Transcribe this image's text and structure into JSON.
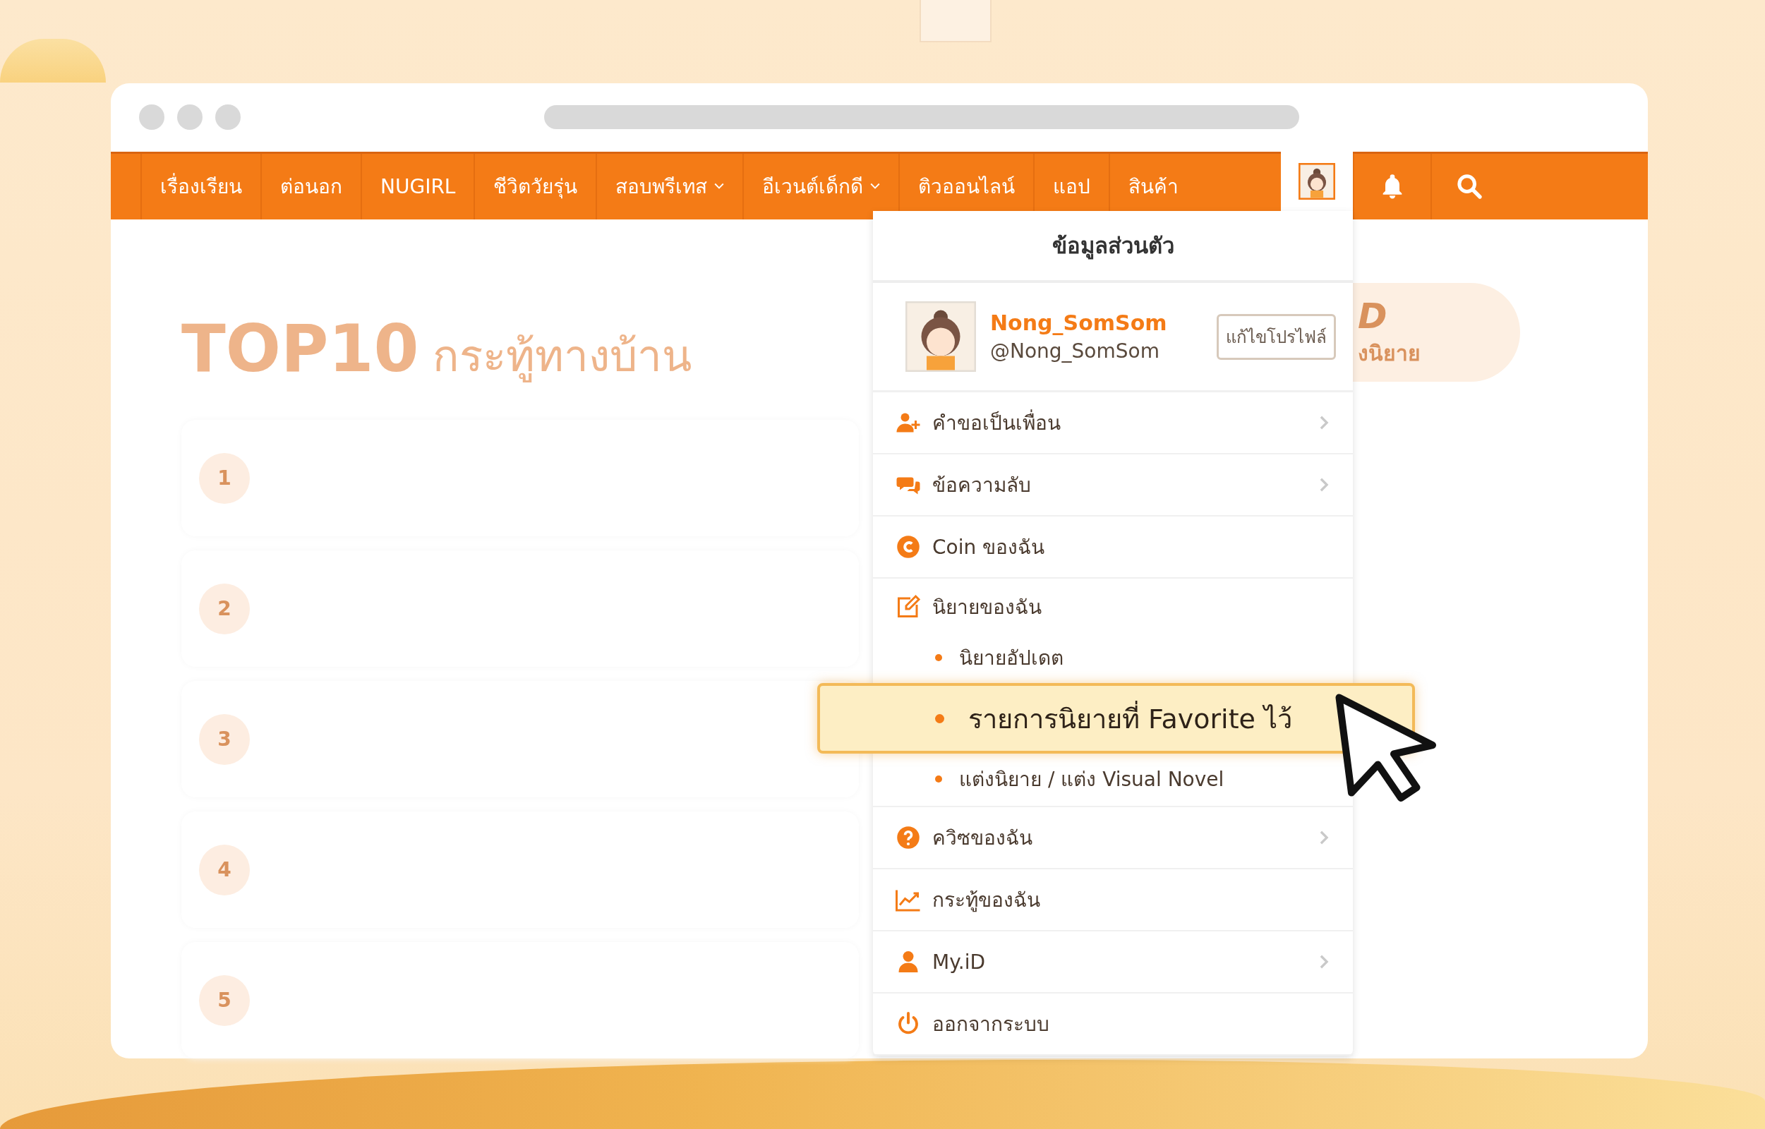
{
  "nav": {
    "items": [
      {
        "label": "เรื่องเรียน",
        "caret": false
      },
      {
        "label": "ต่อนอก",
        "caret": false
      },
      {
        "label": "NUGIRL",
        "caret": false
      },
      {
        "label": "ชีวิตวัยรุ่น",
        "caret": false
      },
      {
        "label": "สอบพรีเทส",
        "caret": true
      },
      {
        "label": "อีเวนต์เด็กดี",
        "caret": true
      },
      {
        "label": "ติวออนไลน์",
        "caret": false
      },
      {
        "label": "แอป",
        "caret": false
      },
      {
        "label": "สินค้า",
        "caret": false
      }
    ],
    "profile_open": true
  },
  "page": {
    "title_main": "TOP10",
    "title_sub": "กระทู้ทางบ้าน",
    "ranks": [
      "1",
      "2",
      "3",
      "4",
      "5"
    ],
    "pill_title": "D",
    "pill_sub": "งนิยาย"
  },
  "dropdown": {
    "title": "ข้อมูลส่วนตัว",
    "display_name": "Nong_SomSom",
    "handle": "@Nong_SomSom",
    "edit_button": "แก้ไขโปรไฟล์",
    "items": [
      {
        "label": "คำขอเป็นเพื่อน",
        "kind": "friends",
        "chevron": true
      },
      {
        "label": "ข้อความลับ",
        "kind": "messages",
        "chevron": true
      },
      {
        "label": "Coin ของฉัน",
        "kind": "coins",
        "chevron": false
      },
      {
        "label": "นิยายของฉัน",
        "kind": "novels",
        "chevron": false,
        "children": [
          {
            "label": "นิยายอัปเดต",
            "selected": false
          },
          {
            "label": "รายการนิยายที่ Favorite ไว้",
            "selected": true
          },
          {
            "label": "แต่งนิยาย / แต่ง Visual Novel",
            "selected": false
          }
        ]
      },
      {
        "label": "ควิซของฉัน",
        "kind": "quizzes",
        "chevron": true
      },
      {
        "label": "กระทู้ของฉัน",
        "kind": "topics",
        "chevron": false
      },
      {
        "label": "My.iD",
        "kind": "account",
        "chevron": true
      },
      {
        "label": "ออกจากระบบ",
        "kind": "logout",
        "chevron": false
      }
    ]
  }
}
